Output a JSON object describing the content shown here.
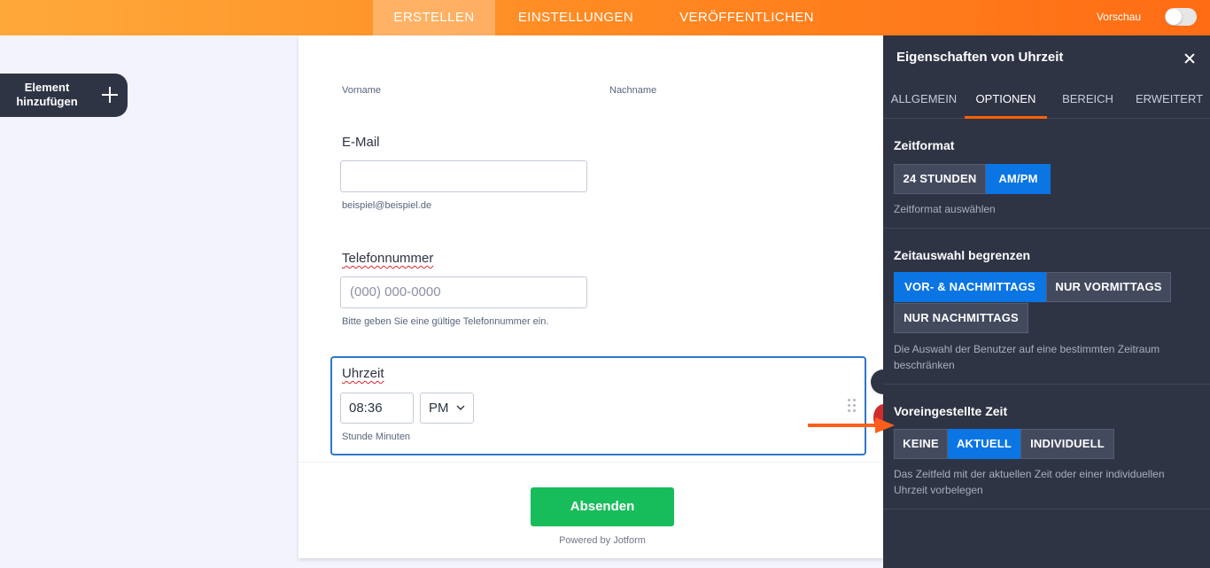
{
  "topbar": {
    "tabs": [
      {
        "label": "ERSTELLEN",
        "active": true
      },
      {
        "label": "EINSTELLUNGEN",
        "active": false
      },
      {
        "label": "VERÖFFENTLICHEN",
        "active": false
      }
    ],
    "preview_label": "Vorschau",
    "preview_on": false
  },
  "add_element": {
    "label": "Element hinzufügen"
  },
  "form": {
    "first_name_sublabel": "Vorname",
    "last_name_sublabel": "Nachname",
    "email_label": "E-Mail",
    "email_sublabel": "beispiel@beispiel.de",
    "phone_label": "Telefonnummer",
    "phone_placeholder": "(000) 000-0000",
    "phone_sublabel": "Bitte geben Sie eine gültige Telefonnummer ein.",
    "time_label": "Uhrzeit",
    "time_value": "08:36",
    "ampm_value": "PM",
    "time_sublabel": "Stunde Minuten",
    "submit_label": "Absenden",
    "powered_by": "Powered by Jotform"
  },
  "panel": {
    "title": "Eigenschaften von Uhrzeit",
    "tabs": [
      {
        "label": "ALLGEMEIN",
        "active": false
      },
      {
        "label": "OPTIONEN",
        "active": true
      },
      {
        "label": "BEREICH",
        "active": false
      },
      {
        "label": "ERWEITERT",
        "active": false
      }
    ],
    "time_format": {
      "heading": "Zeitformat",
      "options": [
        "24 STUNDEN",
        "AM/PM"
      ],
      "selected": "AM/PM",
      "description": "Zeitformat auswählen"
    },
    "limit_time": {
      "heading": "Zeitauswahl begrenzen",
      "options": [
        "VOR- & NACHMITTAGS",
        "NUR VORMITTAGS",
        "NUR NACHMITTAGS"
      ],
      "selected": "VOR- & NACHMITTAGS",
      "description_line1": "Die Auswahl der Benutzer auf eine bestimmten Zeitraum",
      "description_line2": "beschränken"
    },
    "default_time": {
      "heading": "Voreingestellte Zeit",
      "options": [
        "KEINE",
        "AKTUELL",
        "INDIVIDUELL"
      ],
      "selected": "AKTUELL",
      "description_line1": "Das Zeitfeld mit der aktuellen Zeit oder einer individuellen",
      "description_line2": "Uhrzeit vorbelegen"
    }
  },
  "colors": {
    "accent_orange": "#ff6c14",
    "active_blue": "#0a75e3",
    "panel_bg": "#2f3445",
    "submit_green": "#18bd5b",
    "selection_border": "#2d77c6"
  }
}
